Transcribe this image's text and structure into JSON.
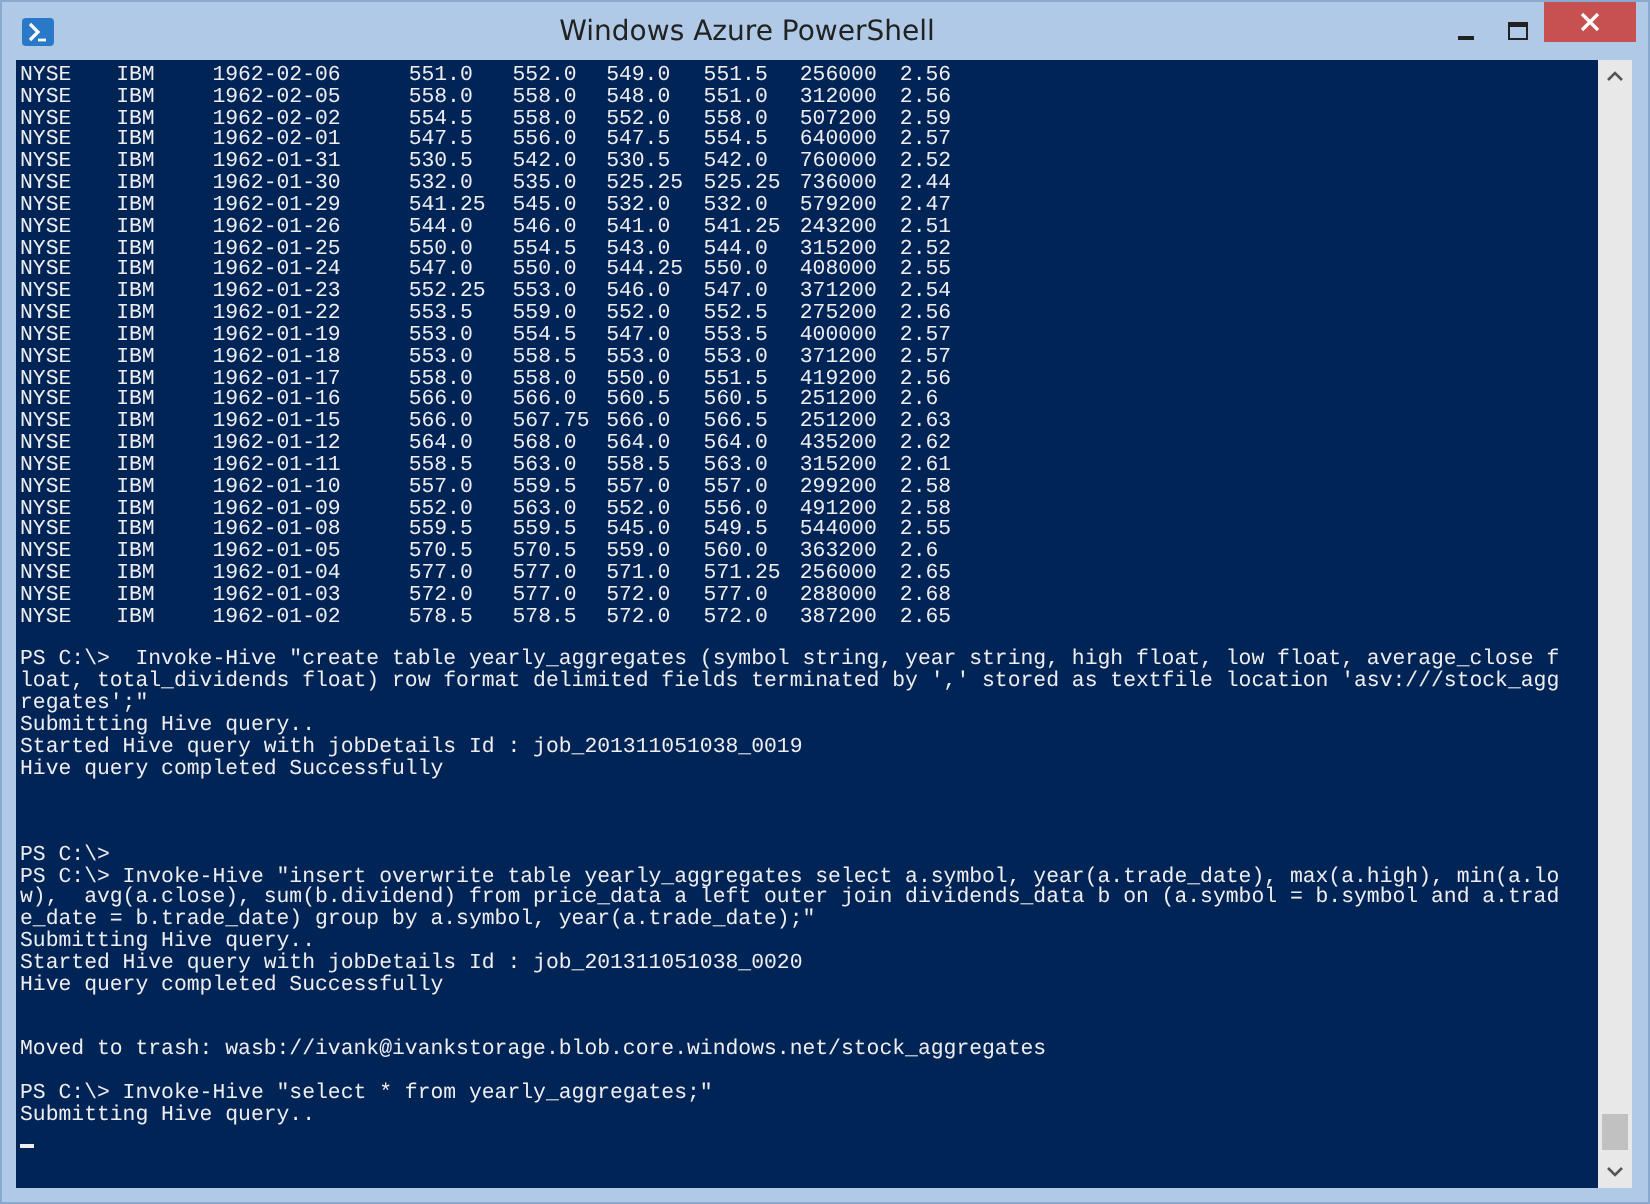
{
  "window": {
    "title": "Windows Azure PowerShell"
  },
  "console": {
    "rows": [
      [
        "NYSE",
        "IBM",
        "1962-02-06",
        "551.0",
        "552.0",
        "549.0",
        "551.5",
        "256000",
        "2.56"
      ],
      [
        "NYSE",
        "IBM",
        "1962-02-05",
        "558.0",
        "558.0",
        "548.0",
        "551.0",
        "312000",
        "2.56"
      ],
      [
        "NYSE",
        "IBM",
        "1962-02-02",
        "554.5",
        "558.0",
        "552.0",
        "558.0",
        "507200",
        "2.59"
      ],
      [
        "NYSE",
        "IBM",
        "1962-02-01",
        "547.5",
        "556.0",
        "547.5",
        "554.5",
        "640000",
        "2.57"
      ],
      [
        "NYSE",
        "IBM",
        "1962-01-31",
        "530.5",
        "542.0",
        "530.5",
        "542.0",
        "760000",
        "2.52"
      ],
      [
        "NYSE",
        "IBM",
        "1962-01-30",
        "532.0",
        "535.0",
        "525.25",
        "525.25",
        "736000",
        "2.44"
      ],
      [
        "NYSE",
        "IBM",
        "1962-01-29",
        "541.25",
        "545.0",
        "532.0",
        "532.0",
        "579200",
        "2.47"
      ],
      [
        "NYSE",
        "IBM",
        "1962-01-26",
        "544.0",
        "546.0",
        "541.0",
        "541.25",
        "243200",
        "2.51"
      ],
      [
        "NYSE",
        "IBM",
        "1962-01-25",
        "550.0",
        "554.5",
        "543.0",
        "544.0",
        "315200",
        "2.52"
      ],
      [
        "NYSE",
        "IBM",
        "1962-01-24",
        "547.0",
        "550.0",
        "544.25",
        "550.0",
        "408000",
        "2.55"
      ],
      [
        "NYSE",
        "IBM",
        "1962-01-23",
        "552.25",
        "553.0",
        "546.0",
        "547.0",
        "371200",
        "2.54"
      ],
      [
        "NYSE",
        "IBM",
        "1962-01-22",
        "553.5",
        "559.0",
        "552.0",
        "552.5",
        "275200",
        "2.56"
      ],
      [
        "NYSE",
        "IBM",
        "1962-01-19",
        "553.0",
        "554.5",
        "547.0",
        "553.5",
        "400000",
        "2.57"
      ],
      [
        "NYSE",
        "IBM",
        "1962-01-18",
        "553.0",
        "558.5",
        "553.0",
        "553.0",
        "371200",
        "2.57"
      ],
      [
        "NYSE",
        "IBM",
        "1962-01-17",
        "558.0",
        "558.0",
        "550.0",
        "551.5",
        "419200",
        "2.56"
      ],
      [
        "NYSE",
        "IBM",
        "1962-01-16",
        "566.0",
        "566.0",
        "560.5",
        "560.5",
        "251200",
        "2.6"
      ],
      [
        "NYSE",
        "IBM",
        "1962-01-15",
        "566.0",
        "567.75",
        "566.0",
        "566.5",
        "251200",
        "2.63"
      ],
      [
        "NYSE",
        "IBM",
        "1962-01-12",
        "564.0",
        "568.0",
        "564.0",
        "564.0",
        "435200",
        "2.62"
      ],
      [
        "NYSE",
        "IBM",
        "1962-01-11",
        "558.5",
        "563.0",
        "558.5",
        "563.0",
        "315200",
        "2.61"
      ],
      [
        "NYSE",
        "IBM",
        "1962-01-10",
        "557.0",
        "559.5",
        "557.0",
        "557.0",
        "299200",
        "2.58"
      ],
      [
        "NYSE",
        "IBM",
        "1962-01-09",
        "552.0",
        "563.0",
        "552.0",
        "556.0",
        "491200",
        "2.58"
      ],
      [
        "NYSE",
        "IBM",
        "1962-01-08",
        "559.5",
        "559.5",
        "545.0",
        "549.5",
        "544000",
        "2.55"
      ],
      [
        "NYSE",
        "IBM",
        "1962-01-05",
        "570.5",
        "570.5",
        "559.0",
        "560.0",
        "363200",
        "2.6"
      ],
      [
        "NYSE",
        "IBM",
        "1962-01-04",
        "577.0",
        "577.0",
        "571.0",
        "571.25",
        "256000",
        "2.65"
      ],
      [
        "NYSE",
        "IBM",
        "1962-01-03",
        "572.0",
        "577.0",
        "572.0",
        "577.0",
        "288000",
        "2.68"
      ],
      [
        "NYSE",
        "IBM",
        "1962-01-02",
        "578.5",
        "578.5",
        "572.0",
        "572.0",
        "387200",
        "2.65"
      ]
    ],
    "lines": [
      {
        "kind": "blank"
      },
      {
        "kind": "text",
        "text": "PS C:\\>  Invoke-Hive \"create table yearly_aggregates (symbol string, year string, high float, low float, average_close f"
      },
      {
        "kind": "text",
        "text": "loat, total_dividends float) row format delimited fields terminated by ',' stored as textfile location 'asv:///stock_agg"
      },
      {
        "kind": "text",
        "text": "regates';\""
      },
      {
        "kind": "text",
        "text": "Submitting Hive query.."
      },
      {
        "kind": "text",
        "text": "Started Hive query with jobDetails Id : job_201311051038_0019"
      },
      {
        "kind": "text",
        "text": "Hive query completed Successfully"
      },
      {
        "kind": "blank"
      },
      {
        "kind": "blank"
      },
      {
        "kind": "blank"
      },
      {
        "kind": "text",
        "text": "PS C:\\>"
      },
      {
        "kind": "text",
        "text": "PS C:\\> Invoke-Hive \"insert overwrite table yearly_aggregates select a.symbol, year(a.trade_date), max(a.high), min(a.lo"
      },
      {
        "kind": "text",
        "text": "w),  avg(a.close), sum(b.dividend) from price_data a left outer join dividends_data b on (a.symbol = b.symbol and a.trad"
      },
      {
        "kind": "text",
        "text": "e_date = b.trade_date) group by a.symbol, year(a.trade_date);\""
      },
      {
        "kind": "text",
        "text": "Submitting Hive query.."
      },
      {
        "kind": "text",
        "text": "Started Hive query with jobDetails Id : job_201311051038_0020"
      },
      {
        "kind": "text",
        "text": "Hive query completed Successfully"
      },
      {
        "kind": "blank"
      },
      {
        "kind": "blank"
      },
      {
        "kind": "text",
        "text": "Moved to trash: wasb://ivank@ivankstorage.blob.core.windows.net/stock_aggregates"
      },
      {
        "kind": "blank"
      },
      {
        "kind": "text",
        "text": "PS C:\\> Invoke-Hive \"select * from yearly_aggregates;\""
      },
      {
        "kind": "text",
        "text": "Submitting Hive query.."
      },
      {
        "kind": "cursor"
      }
    ]
  }
}
